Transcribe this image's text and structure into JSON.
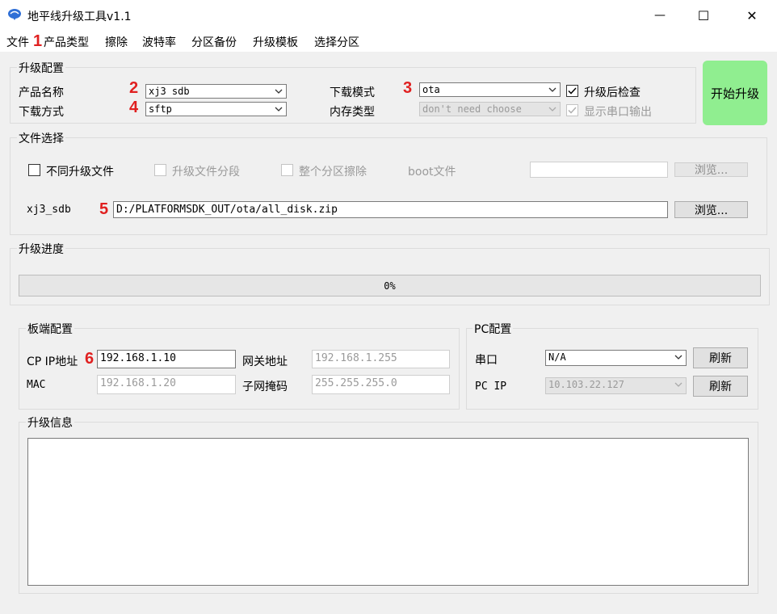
{
  "window": {
    "title": "地平线升级工具v1.1",
    "minimize_glyph": "—",
    "maximize_glyph": "☐",
    "close_glyph": "✕"
  },
  "menu": {
    "file": "文件",
    "product_type": "产品类型",
    "erase": "擦除",
    "baud_rate": "波特率",
    "partition_backup": "分区备份",
    "upgrade_template": "升级模板",
    "select_partition": "选择分区"
  },
  "annotations": {
    "n1": "1",
    "n2": "2",
    "n3": "3",
    "n4": "4",
    "n5": "5",
    "n6": "6"
  },
  "upgrade_config": {
    "title": "升级配置",
    "product_name_label": "产品名称",
    "product_name_value": "xj3 sdb",
    "download_method_label": "下载方式",
    "download_method_value": "sftp",
    "download_mode_label": "下载模式",
    "download_mode_value": "ota",
    "memory_type_label": "内存类型",
    "memory_type_value": "don't need choose",
    "check_after_upgrade_label": "升级后检查",
    "check_after_upgrade_checked": true,
    "show_serial_output_label": "显示串口输出",
    "show_serial_output_checked": true
  },
  "start_button_label": "开始升级",
  "file_select": {
    "title": "文件选择",
    "diff_upgrade_label": "不同升级文件",
    "segment_label": "升级文件分段",
    "erase_partition_label": "整个分区擦除",
    "boot_file_label": "boot文件",
    "boot_file_value": "",
    "browse_label": "浏览...",
    "file_label": "xj3_sdb",
    "file_path": "D:/PLATFORMSDK_OUT/ota/all_disk.zip",
    "browse2_label": "浏览..."
  },
  "progress": {
    "title": "升级进度",
    "text": "0%",
    "value": 0
  },
  "board_config": {
    "title": "板端配置",
    "cp_ip_label": "CP IP地址",
    "cp_ip_value": "192.168.1.10",
    "gateway_label": "网关地址",
    "gateway_value": "192.168.1.255",
    "mac_label": "MAC",
    "mac_value": "192.168.1.20",
    "subnet_label": "子网掩码",
    "subnet_value": "255.255.255.0"
  },
  "pc_config": {
    "title": "PC配置",
    "serial_label": "串口",
    "serial_value": "N/A",
    "refresh1_label": "刷新",
    "pc_ip_label": "PC IP",
    "pc_ip_value": "10.103.22.127",
    "refresh2_label": "刷新"
  },
  "upgrade_info": {
    "title": "升级信息",
    "log_text": ""
  },
  "colors": {
    "start_button": "#90ee90",
    "annotation_red": "#e02020",
    "background": "#f0f0f0"
  }
}
